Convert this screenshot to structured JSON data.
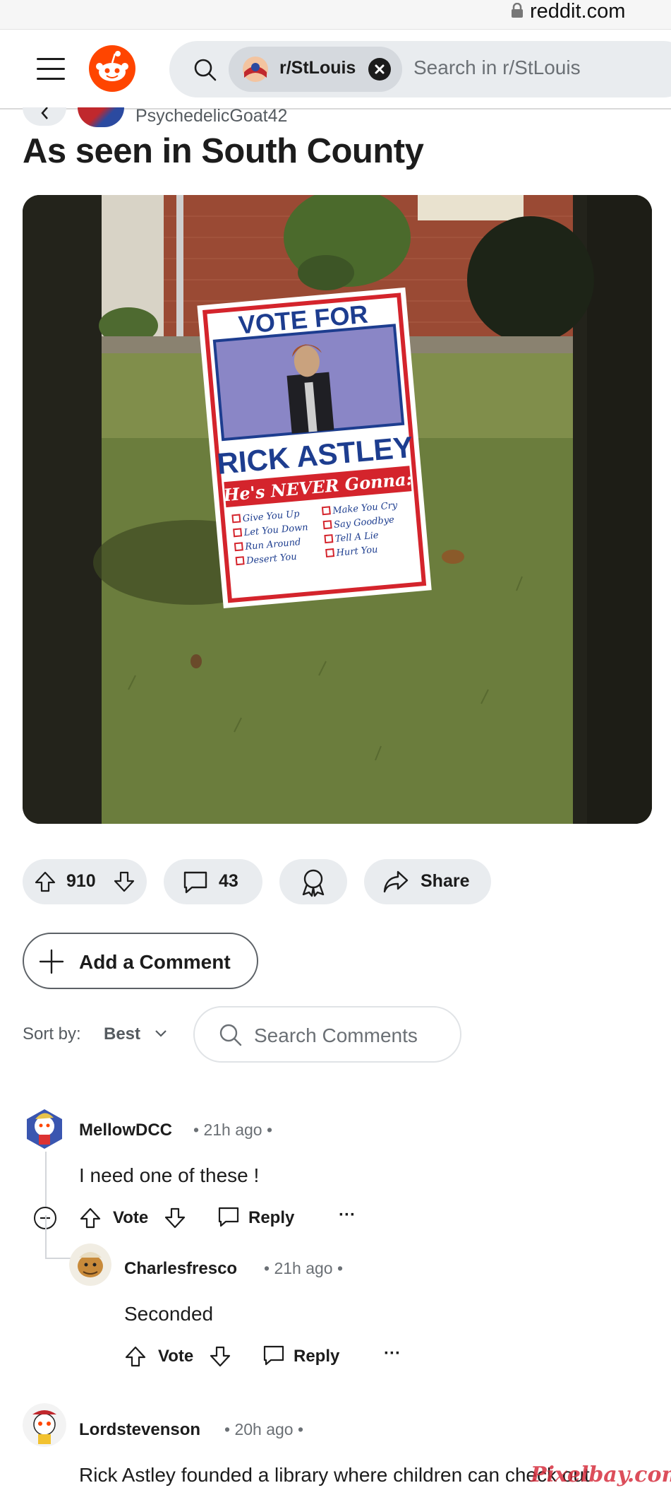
{
  "browser": {
    "url": "reddit.com"
  },
  "header": {
    "subreddit_chip": "r/StLouis",
    "search_placeholder": "Search in r/StLouis"
  },
  "post": {
    "author": "PsychedelicGoat42",
    "title": "As seen in South County",
    "image_sign": {
      "heading": "VOTE FOR",
      "name": "RICK ASTLEY",
      "subheading": "He's NEVER Gonna:",
      "left_list": [
        "Give You Up",
        "Let You Down",
        "Run Around",
        "Desert You"
      ],
      "right_list": [
        "Make You Cry",
        "Say Goodbye",
        "Tell A Lie",
        "Hurt You"
      ]
    },
    "votes": "910",
    "comments_count": "43",
    "share_label": "Share"
  },
  "add_comment_label": "Add a Comment",
  "sort": {
    "label": "Sort by:",
    "value": "Best"
  },
  "search_comments_placeholder": "Search Comments",
  "comments": [
    {
      "user": "MellowDCC",
      "time": "• 21h ago •",
      "body": "I need one of these !",
      "vote_label": "Vote",
      "reply_label": "Reply",
      "more": "···"
    },
    {
      "user": "Charlesfresco",
      "time": "• 21h ago •",
      "body": "Seconded",
      "vote_label": "Vote",
      "reply_label": "Reply",
      "more": "···"
    },
    {
      "user": "Lordstevenson",
      "time": "• 20h ago •",
      "body": "Rick Astley founded a library where children can check out"
    }
  ],
  "watermark": "Pixelbay.com",
  "colors": {
    "reddit_orange": "#ff4500",
    "pill_bg": "#e9ecef",
    "sign_red": "#d4242c",
    "sign_blue": "#1d3d8f"
  }
}
